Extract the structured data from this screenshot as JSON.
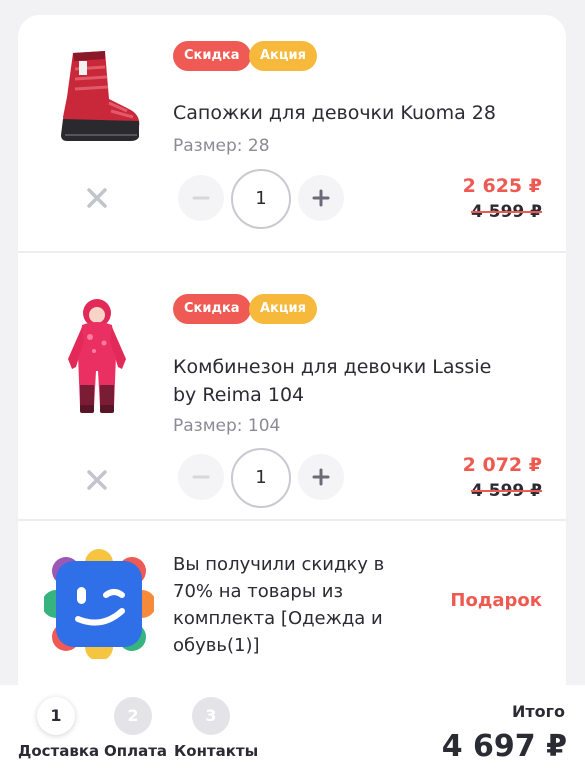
{
  "cart": {
    "items": [
      {
        "badges": [
          "Скидка",
          "Акция"
        ],
        "title": "Сапожки для девочки Kuoma 28",
        "size": "Размер: 28",
        "quantity": "1",
        "price": "2 625 ₽",
        "old_price": "4 599 ₽",
        "image_icon": "boot-icon"
      },
      {
        "badges": [
          "Скидка",
          "Акция"
        ],
        "title_line1": "Комбинезон для девочки Lassie",
        "title_line2": "by Reima 104",
        "size": "Размер: 104",
        "quantity": "1",
        "price": "2 072 ₽",
        "old_price": "4 599 ₽",
        "image_icon": "jumpsuit-icon"
      }
    ],
    "gift": {
      "text": "Вы получили скидку в 70% на товары из комплекта [Одежда и обувь(1)]",
      "tag": "Подарок",
      "icon": "wink-face-icon"
    }
  },
  "checkout": {
    "steps": [
      {
        "number": "1",
        "label": "Доставка",
        "active": true
      },
      {
        "number": "2",
        "label": "Оплата",
        "active": false
      },
      {
        "number": "3",
        "label": "Контакты",
        "active": false
      }
    ],
    "total_label": "Итого",
    "total_value": "4 697 ₽"
  },
  "colors": {
    "accent_red": "#ee5a52",
    "badge_sale": "#ef5a55",
    "badge_promo": "#f6b93b",
    "step_idle": "#e3e3e8"
  }
}
